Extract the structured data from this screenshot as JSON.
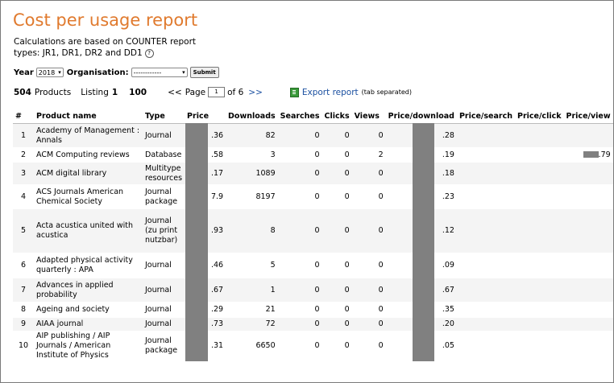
{
  "title": "Cost per usage report",
  "calc_text": "Calculations are based on COUNTER report types: JR1, DR1, DR2 and DD1",
  "help_icon": "?",
  "filters": {
    "year_label": "Year",
    "year_value": "2018",
    "org_label": "Organisation:",
    "org_value": "------------",
    "submit_label": "Submit"
  },
  "pager": {
    "count": "504",
    "products_label": "Products",
    "listing_label": "Listing",
    "listing_from": "1",
    "listing_to": "100",
    "prev": "<<",
    "page_label": "Page",
    "page_value": "1",
    "of_label": "of 6",
    "next": ">>",
    "export_label": "Export report",
    "export_note": "(tab separated)"
  },
  "headers": [
    "#",
    "Product name",
    "Type",
    "Price",
    "Downloads",
    "Searches",
    "Clicks",
    "Views",
    "Price/download",
    "Price/search",
    "Price/click",
    "Price/view"
  ],
  "rows": [
    {
      "n": "1",
      "name": "Academy of Management : Annals",
      "type": "Journal",
      "price": ".36",
      "dl": "82",
      "s": "0",
      "c": "0",
      "v": "0",
      "ppd": ".28",
      "pps": "",
      "ppc": "",
      "ppv": ""
    },
    {
      "n": "2",
      "name": "ACM Computing reviews",
      "type": "Database",
      "price": ".58",
      "dl": "3",
      "s": "0",
      "c": "0",
      "v": "2",
      "ppd": ".19",
      "pps": "",
      "ppc": "",
      "ppv": ".79"
    },
    {
      "n": "3",
      "name": "ACM digital library",
      "type": "Multitype resources",
      "price": ".17",
      "dl": "1089",
      "s": "0",
      "c": "0",
      "v": "0",
      "ppd": ".18",
      "pps": "",
      "ppc": "",
      "ppv": ""
    },
    {
      "n": "4",
      "name": "ACS Journals American Chemical Society",
      "type": "Journal package",
      "price": "7.9",
      "dl": "8197",
      "s": "0",
      "c": "0",
      "v": "0",
      "ppd": ".23",
      "pps": "",
      "ppc": "",
      "ppv": ""
    },
    {
      "n": "5",
      "name": "Acta acustica united with acustica",
      "type": "Journal (zu print nutzbar)",
      "price": ".93",
      "dl": "8",
      "s": "0",
      "c": "0",
      "v": "0",
      "ppd": ".12",
      "pps": "",
      "ppc": "",
      "ppv": ""
    },
    {
      "n": "6",
      "name": "Adapted physical activity quarterly : APA",
      "type": "Journal",
      "price": ".46",
      "dl": "5",
      "s": "0",
      "c": "0",
      "v": "0",
      "ppd": ".09",
      "pps": "",
      "ppc": "",
      "ppv": ""
    },
    {
      "n": "7",
      "name": "Advances in applied probability",
      "type": "Journal",
      "price": ".67",
      "dl": "1",
      "s": "0",
      "c": "0",
      "v": "0",
      "ppd": ".67",
      "pps": "",
      "ppc": "",
      "ppv": ""
    },
    {
      "n": "8",
      "name": "Ageing and society",
      "type": "Journal",
      "price": ".29",
      "dl": "21",
      "s": "0",
      "c": "0",
      "v": "0",
      "ppd": ".35",
      "pps": "",
      "ppc": "",
      "ppv": ""
    },
    {
      "n": "9",
      "name": "AIAA journal",
      "type": "Journal",
      "price": ".73",
      "dl": "72",
      "s": "0",
      "c": "0",
      "v": "0",
      "ppd": ".20",
      "pps": "",
      "ppc": "",
      "ppv": ""
    },
    {
      "n": "10",
      "name": "AIP publishing / AIP Journals / American Institute of Physics",
      "type": "Journal package",
      "price": ".31",
      "dl": "6650",
      "s": "0",
      "c": "0",
      "v": "0",
      "ppd": ".05",
      "pps": "",
      "ppc": "",
      "ppv": ""
    }
  ]
}
